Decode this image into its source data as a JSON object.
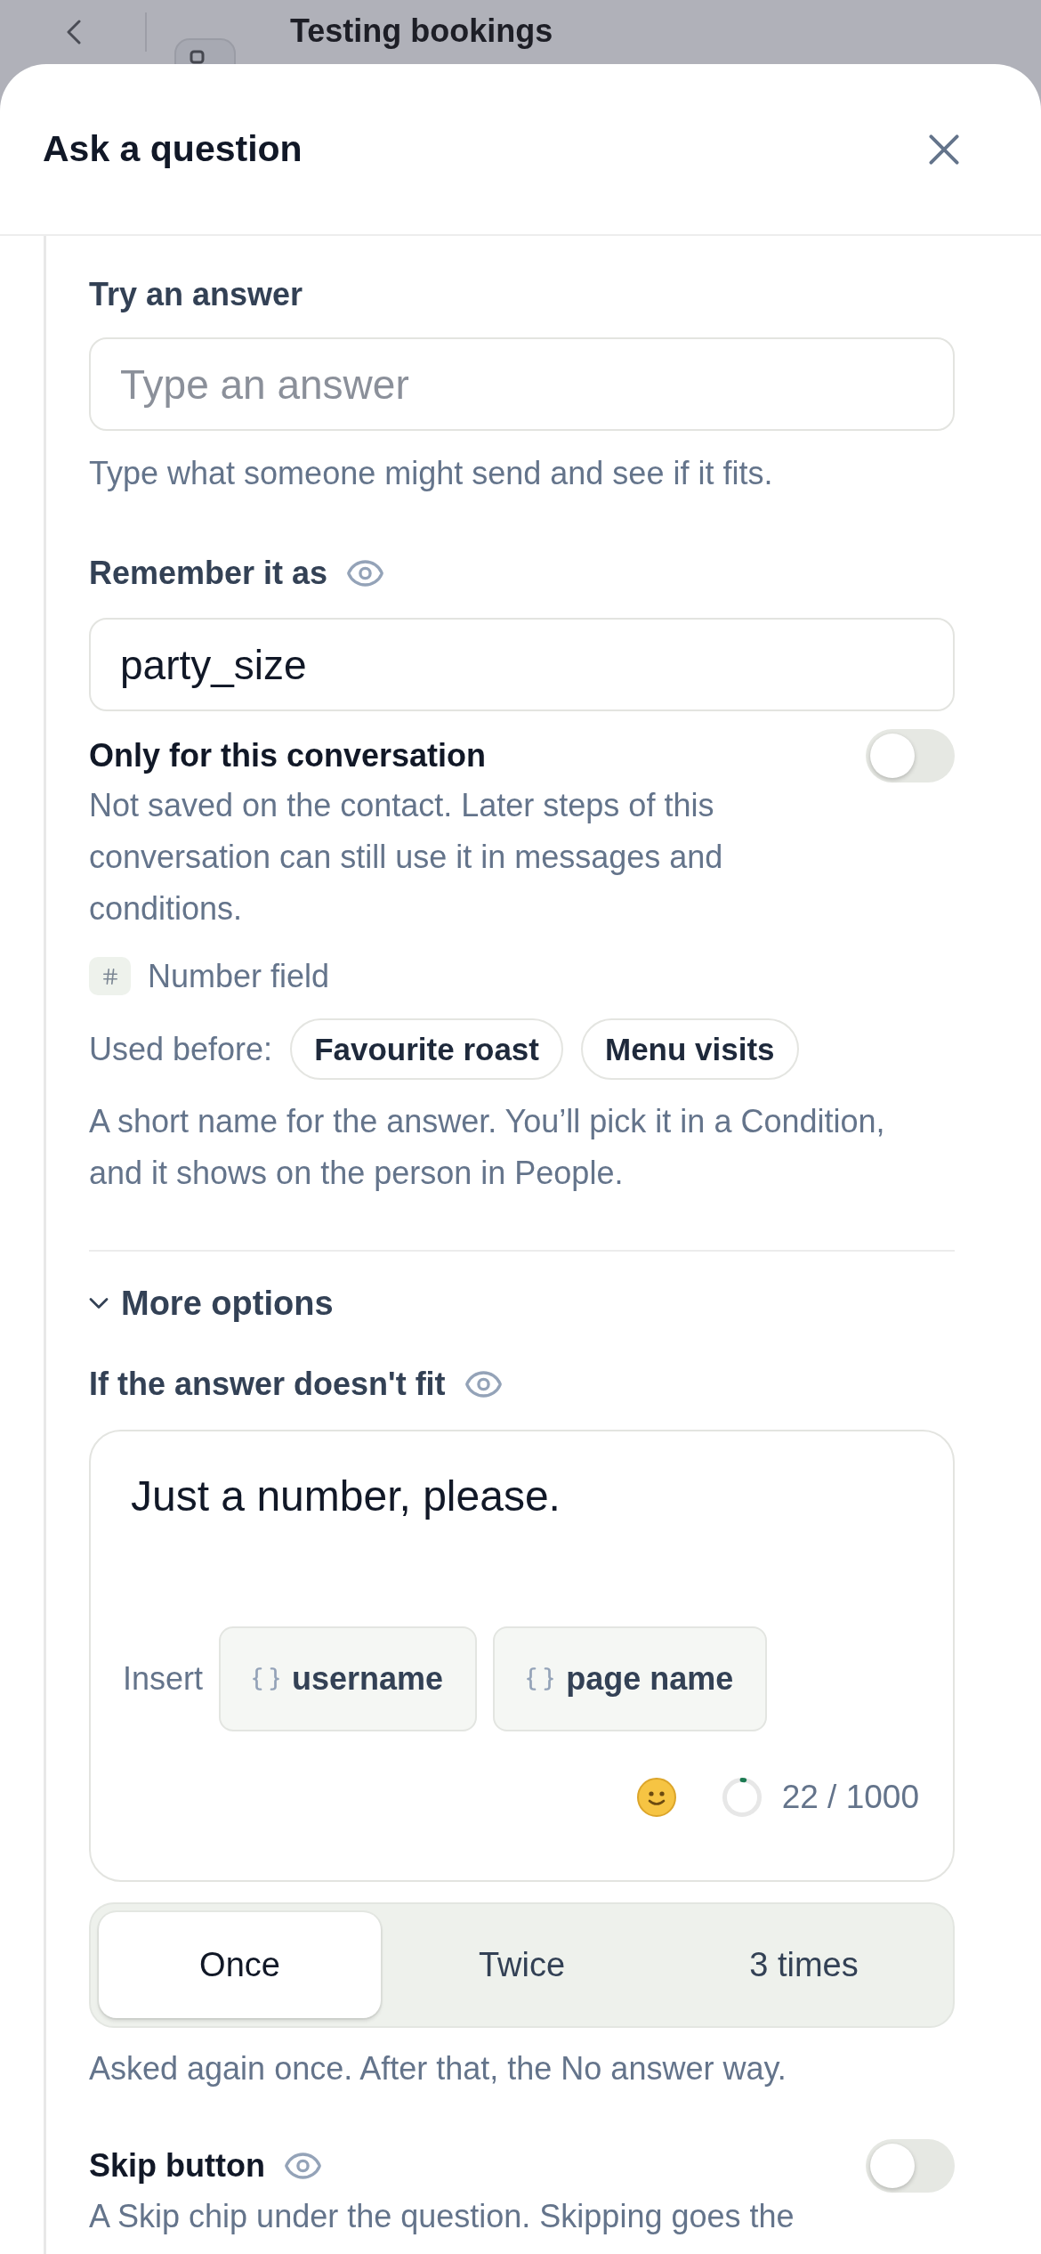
{
  "background": {
    "title": "Testing bookings"
  },
  "sheet": {
    "title": "Ask a question"
  },
  "try_answer": {
    "label": "Try an answer",
    "placeholder": "Type an answer",
    "help": "Type what someone might send and see if it fits."
  },
  "remember": {
    "label": "Remember it as",
    "value": "party_size",
    "conversation_only": {
      "label": "Only for this conversation",
      "on": false,
      "description": "Not saved on the contact. Later steps of this conversation can still use it in messages and conditions."
    },
    "field_type": "Number field",
    "used_before": {
      "label": "Used before:",
      "chips": [
        "Favourite roast",
        "Menu visits"
      ]
    },
    "help": "A short name for the answer. You’ll pick it in a Condition, and it shows on the person in People."
  },
  "more_options": {
    "label": "More options",
    "expanded": true
  },
  "fallback": {
    "label": "If the answer doesn't fit",
    "message": "Just a number, please.",
    "insert_label": "Insert",
    "variables": [
      "username",
      "page name"
    ],
    "counter": "22 / 1000",
    "retries": [
      {
        "label": "Once",
        "selected": true
      },
      {
        "label": "Twice",
        "selected": false
      },
      {
        "label": "3 times",
        "selected": false
      }
    ],
    "help": "Asked again once. After that, the No answer way."
  },
  "skip": {
    "label": "Skip button",
    "on": false,
    "description": "A Skip chip under the question. Skipping goes the"
  }
}
